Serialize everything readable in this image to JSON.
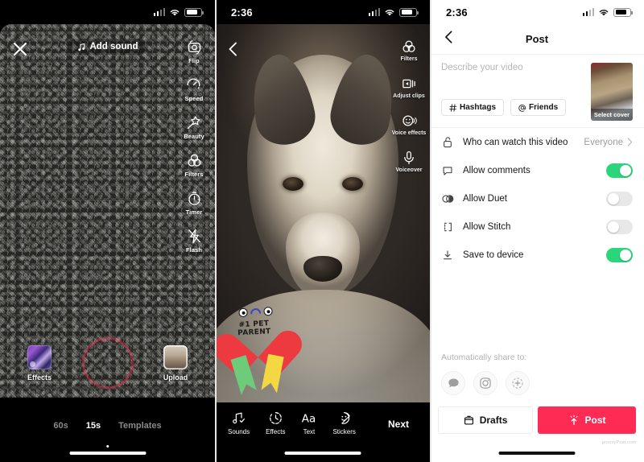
{
  "colors": {
    "tiktok_red": "#FE2C55",
    "toggle_green": "#2BD67B",
    "toggle_off": "#E8E8E8",
    "dark_bg": "#000000",
    "light_bg": "#FFFFFF"
  },
  "camera_screen": {
    "status": {
      "time": "",
      "icons": [
        "signal-bars",
        "wifi",
        "battery"
      ]
    },
    "close_label": "Close",
    "add_sound": {
      "label": "Add sound",
      "icon": "music-note-icon"
    },
    "tools": [
      {
        "label": "Flip",
        "icon": "flip-camera-icon"
      },
      {
        "label": "Speed",
        "icon": "speed-icon"
      },
      {
        "label": "Beauty",
        "icon": "beauty-wand-icon"
      },
      {
        "label": "Filters",
        "icon": "filters-icon"
      },
      {
        "label": "Timer",
        "icon": "timer-icon"
      },
      {
        "label": "Flash",
        "icon": "flash-icon"
      }
    ],
    "effects_label": "Effects",
    "upload_label": "Upload",
    "record_label": "Record",
    "modes": [
      {
        "label": "60s",
        "active": false
      },
      {
        "label": "15s",
        "active": true
      },
      {
        "label": "Templates",
        "active": false
      }
    ]
  },
  "preview_screen": {
    "status": {
      "time": "2:36",
      "icons": [
        "signal-bars",
        "wifi",
        "battery"
      ]
    },
    "back_label": "Back",
    "tools": [
      {
        "label": "Filters",
        "icon": "filters-icon"
      },
      {
        "label": "Adjust clips",
        "icon": "adjust-clips-icon"
      },
      {
        "label": "Voice effects",
        "icon": "voice-effects-icon"
      },
      {
        "label": "Voiceover",
        "icon": "microphone-icon"
      }
    ],
    "sticker": {
      "line1": "#1 PET",
      "line2": "PARENT"
    },
    "edit_tools": [
      {
        "label": "Sounds",
        "icon": "music-note-check-icon"
      },
      {
        "label": "Effects",
        "icon": "effects-clock-icon"
      },
      {
        "label": "Text",
        "icon": "text-aa-icon"
      },
      {
        "label": "Stickers",
        "icon": "sticker-smiley-icon"
      }
    ],
    "next_label": "Next"
  },
  "post_screen": {
    "status": {
      "time": "2:36",
      "icons": [
        "signal-bars",
        "wifi",
        "battery"
      ]
    },
    "header": {
      "title": "Post",
      "back_label": "Back"
    },
    "description": {
      "placeholder": "Describe your video",
      "value": ""
    },
    "chips": [
      {
        "label": "Hashtags",
        "icon": "hashtag-icon"
      },
      {
        "label": "Friends",
        "icon": "at-mention-icon"
      }
    ],
    "cover": {
      "label": "Select cover"
    },
    "settings": [
      {
        "label": "Who can watch this video",
        "icon": "unlock-icon",
        "control": "value",
        "value": "Everyone",
        "chevron": "chevron-right-icon"
      },
      {
        "label": "Allow comments",
        "icon": "comment-bubble-icon",
        "control": "toggle",
        "state": "on"
      },
      {
        "label": "Allow Duet",
        "icon": "duet-icon",
        "control": "toggle",
        "state": "off"
      },
      {
        "label": "Allow Stitch",
        "icon": "stitch-icon",
        "control": "toggle",
        "state": "off"
      },
      {
        "label": "Save to device",
        "icon": "download-icon",
        "control": "toggle",
        "state": "on"
      }
    ],
    "share": {
      "label": "Automatically share to:",
      "targets": [
        {
          "icon": "message-bubble-icon",
          "name": "sms"
        },
        {
          "icon": "instagram-icon",
          "name": "instagram"
        },
        {
          "icon": "add-more-icon",
          "name": "more"
        }
      ]
    },
    "actions": {
      "drafts": {
        "label": "Drafts",
        "icon": "drafts-box-icon"
      },
      "post": {
        "label": "Post",
        "icon": "upload-sparkle-icon"
      }
    },
    "watermark": "groovyPost.com"
  }
}
